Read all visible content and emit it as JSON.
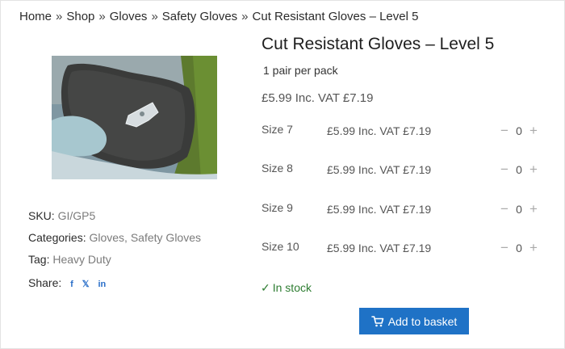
{
  "breadcrumb": {
    "items": [
      "Home",
      "Shop",
      "Gloves",
      "Safety Gloves",
      "Cut Resistant Gloves – Level 5"
    ],
    "separator": "»"
  },
  "product": {
    "title": "Cut Resistant Gloves – Level 5",
    "subtitle": "1 pair per pack",
    "price": "£5.99 Inc. VAT £7.19",
    "image_icon": "product-photo-glove-holding-blade"
  },
  "meta": {
    "sku_label": "SKU:",
    "sku_value": "GI/GP5",
    "categories_label": "Categories:",
    "categories": [
      "Gloves,",
      "Safety Gloves"
    ],
    "tag_label": "Tag:",
    "tag_value": "Heavy Duty",
    "share_label": "Share:",
    "share_icons": [
      "facebook-icon",
      "x-icon",
      "linkedin-icon"
    ],
    "share_glyphs": [
      "f",
      "𝕏",
      "in"
    ]
  },
  "variants": [
    {
      "size": "Size 7",
      "price": "£5.99 Inc. VAT £7.19",
      "qty": "0"
    },
    {
      "size": "Size 8",
      "price": "£5.99 Inc. VAT £7.19",
      "qty": "0"
    },
    {
      "size": "Size 9",
      "price": "£5.99 Inc. VAT £7.19",
      "qty": "0"
    },
    {
      "size": "Size 10",
      "price": "£5.99 Inc. VAT £7.19",
      "qty": "0"
    }
  ],
  "qty_controls": {
    "minus": "−",
    "plus": "+"
  },
  "stock": {
    "text": "In stock",
    "check": "✓"
  },
  "basket": {
    "label": "Add to basket",
    "icon": "cart-icon"
  },
  "colors": {
    "accent": "#1f72c6",
    "stock": "#2e7d32",
    "link": "#7b7b7b"
  }
}
